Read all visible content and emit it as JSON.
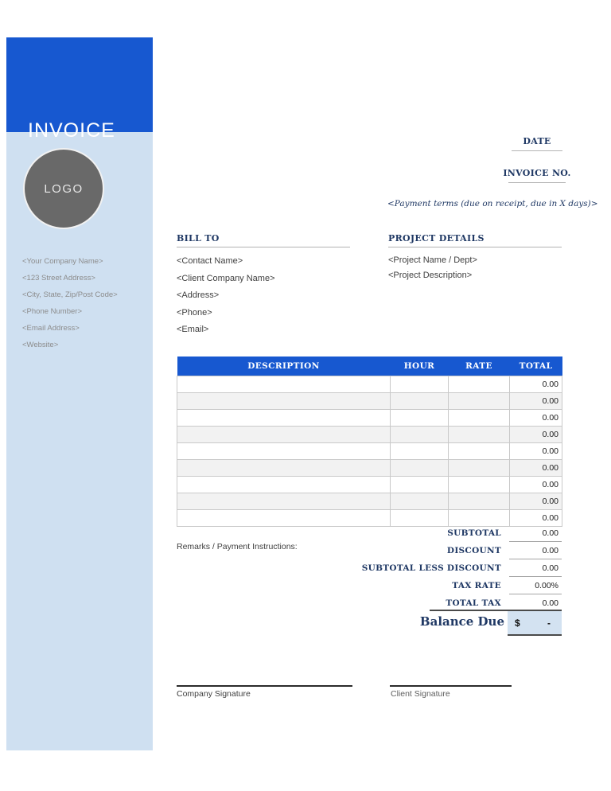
{
  "sidebar": {
    "title": "INVOICE",
    "logo": "LOGO",
    "company_info": [
      "<Your Company Name>",
      "<123 Street Address>",
      "<City, State, Zip/Post Code>",
      "<Phone Number>",
      "<Email Address>",
      "<Website>"
    ]
  },
  "invoice_meta": {
    "date_label": "DATE",
    "invoice_no_label": "INVOICE NO.",
    "payment_terms": "<Payment terms (due on receipt, due in X days)>"
  },
  "bill_to": {
    "label": "BILL TO",
    "items": [
      "<Contact Name>",
      "<Client Company Name>",
      "<Address>",
      "<Phone>",
      "<Email>"
    ]
  },
  "project_details": {
    "label": "PROJECT DETAILS",
    "items": [
      "<Project Name / Dept>",
      "<Project Description>"
    ]
  },
  "items_table": {
    "columns": [
      "DESCRIPTION",
      "HOUR",
      "RATE",
      "TOTAL"
    ],
    "rows": [
      {
        "description": "",
        "hour": "",
        "rate": "",
        "total": "0.00"
      },
      {
        "description": "",
        "hour": "",
        "rate": "",
        "total": "0.00"
      },
      {
        "description": "",
        "hour": "",
        "rate": "",
        "total": "0.00"
      },
      {
        "description": "",
        "hour": "",
        "rate": "",
        "total": "0.00"
      },
      {
        "description": "",
        "hour": "",
        "rate": "",
        "total": "0.00"
      },
      {
        "description": "",
        "hour": "",
        "rate": "",
        "total": "0.00"
      },
      {
        "description": "",
        "hour": "",
        "rate": "",
        "total": "0.00"
      },
      {
        "description": "",
        "hour": "",
        "rate": "",
        "total": "0.00"
      },
      {
        "description": "",
        "hour": "",
        "rate": "",
        "total": "0.00"
      }
    ]
  },
  "totals": {
    "rows": [
      {
        "label": "SUBTOTAL",
        "value": "0.00"
      },
      {
        "label": "DISCOUNT",
        "value": "0.00"
      },
      {
        "label": "SUBTOTAL LESS DISCOUNT",
        "value": "0.00"
      },
      {
        "label": "TAX RATE",
        "value": "0.00%"
      },
      {
        "label": "TOTAL TAX",
        "value": "0.00"
      }
    ],
    "balance_due_label": "Balance Due",
    "currency_symbol": "$",
    "balance_value": "-"
  },
  "remarks_label": "Remarks / Payment Instructions:",
  "signatures": {
    "company_label": "Company Signature",
    "client_label": "Client Signature"
  },
  "colors": {
    "accent_blue": "#1758d0",
    "sidebar_bg": "#cfe0f1",
    "navy_text": "#1f3864",
    "logo_gray": "#696969",
    "balance_cell_bg": "#d3e2f1"
  }
}
